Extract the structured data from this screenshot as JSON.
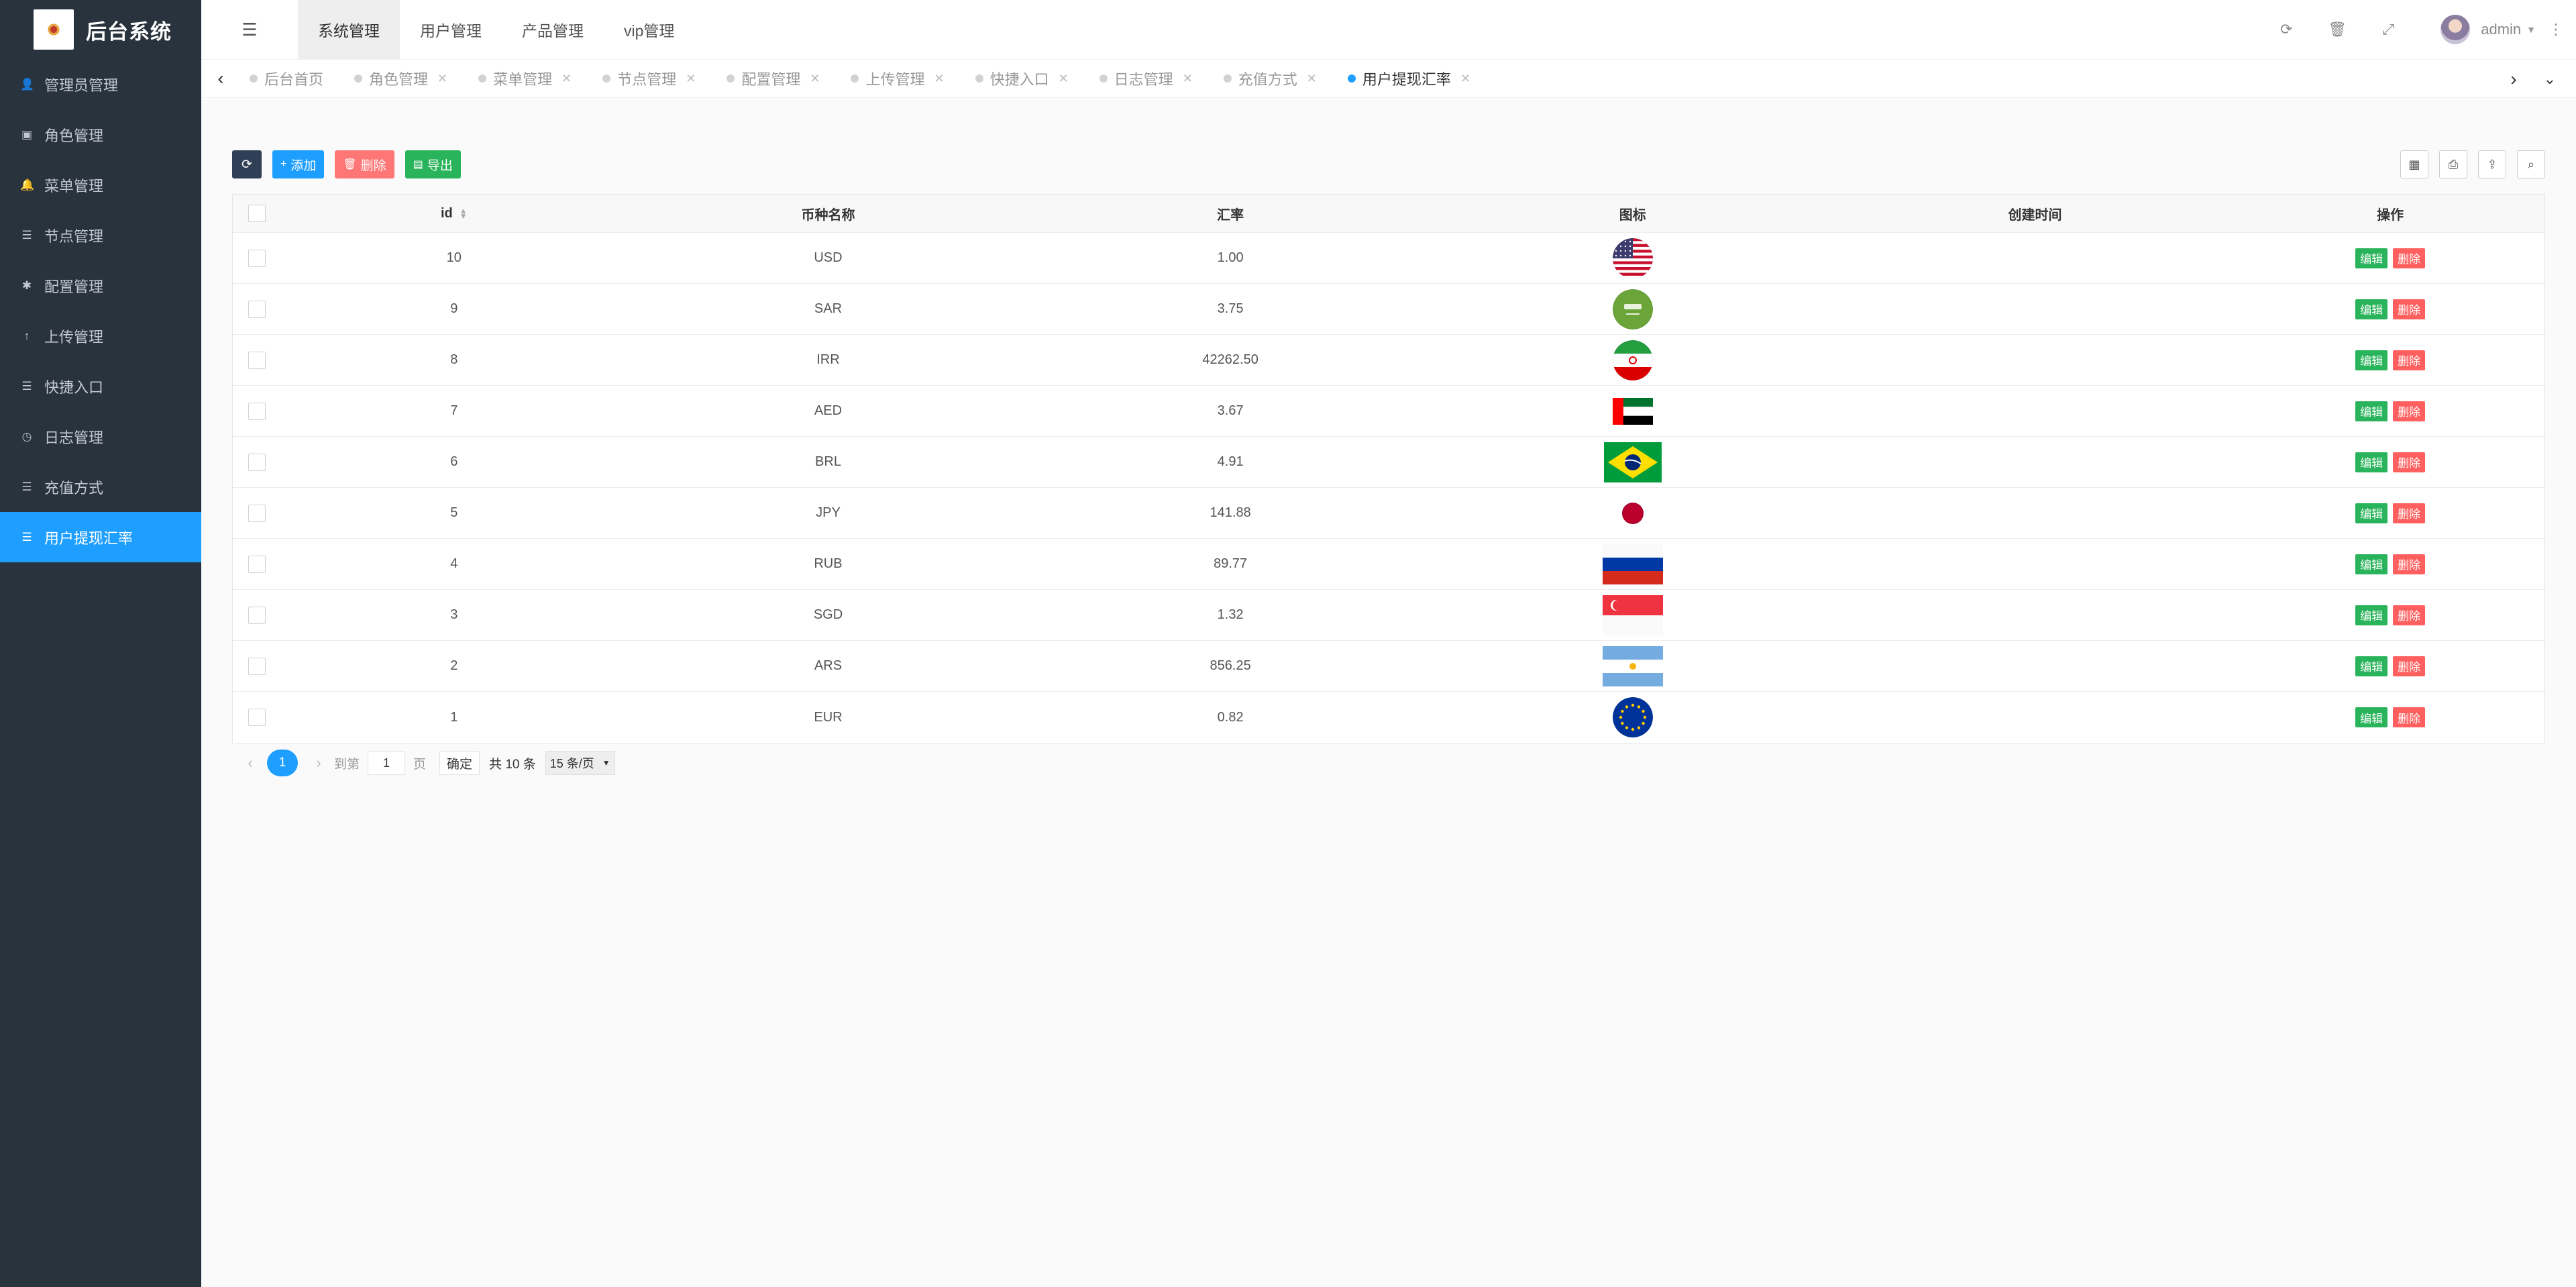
{
  "app": {
    "title": "后台系统"
  },
  "sidebar": {
    "items": [
      {
        "label": "管理员管理",
        "icon": "user-icon"
      },
      {
        "label": "角色管理",
        "icon": "id-card-icon"
      },
      {
        "label": "菜单管理",
        "icon": "bell-icon"
      },
      {
        "label": "节点管理",
        "icon": "list-icon"
      },
      {
        "label": "配置管理",
        "icon": "gear-icon"
      },
      {
        "label": "上传管理",
        "icon": "upload-icon"
      },
      {
        "label": "快捷入口",
        "icon": "list-icon"
      },
      {
        "label": "日志管理",
        "icon": "clock-icon"
      },
      {
        "label": "充值方式",
        "icon": "list-icon"
      },
      {
        "label": "用户提现汇率",
        "icon": "list-icon",
        "active": true
      }
    ]
  },
  "header": {
    "nav": [
      "系统管理",
      "用户管理",
      "产品管理",
      "vip管理"
    ],
    "user": "admin"
  },
  "tabs": [
    {
      "label": "后台首页",
      "closable": false
    },
    {
      "label": "角色管理",
      "closable": true
    },
    {
      "label": "菜单管理",
      "closable": true
    },
    {
      "label": "节点管理",
      "closable": true
    },
    {
      "label": "配置管理",
      "closable": true
    },
    {
      "label": "上传管理",
      "closable": true
    },
    {
      "label": "快捷入口",
      "closable": true
    },
    {
      "label": "日志管理",
      "closable": true
    },
    {
      "label": "充值方式",
      "closable": true
    },
    {
      "label": "用户提现汇率",
      "closable": true,
      "active": true
    }
  ],
  "toolbar": {
    "add_label": "添加",
    "delete_label": "删除",
    "export_label": "导出"
  },
  "table": {
    "columns": [
      "id",
      "币种名称",
      "汇率",
      "图标",
      "创建时间",
      "操作"
    ],
    "edit_label": "编辑",
    "delete_label": "删除",
    "rows": [
      {
        "id": "10",
        "name": "USD",
        "rate": "1.00",
        "flag": "us",
        "created": ""
      },
      {
        "id": "9",
        "name": "SAR",
        "rate": "3.75",
        "flag": "sa",
        "created": ""
      },
      {
        "id": "8",
        "name": "IRR",
        "rate": "42262.50",
        "flag": "ir",
        "created": ""
      },
      {
        "id": "7",
        "name": "AED",
        "rate": "3.67",
        "flag": "ae",
        "created": ""
      },
      {
        "id": "6",
        "name": "BRL",
        "rate": "4.91",
        "flag": "br",
        "created": ""
      },
      {
        "id": "5",
        "name": "JPY",
        "rate": "141.88",
        "flag": "jp",
        "created": ""
      },
      {
        "id": "4",
        "name": "RUB",
        "rate": "89.77",
        "flag": "ru",
        "created": ""
      },
      {
        "id": "3",
        "name": "SGD",
        "rate": "1.32",
        "flag": "sg",
        "created": ""
      },
      {
        "id": "2",
        "name": "ARS",
        "rate": "856.25",
        "flag": "ar",
        "created": ""
      },
      {
        "id": "1",
        "name": "EUR",
        "rate": "0.82",
        "flag": "eu",
        "created": ""
      }
    ]
  },
  "pagination": {
    "current": "1",
    "goto_label": "到第",
    "page_input": "1",
    "page_unit": "页",
    "confirm_label": "确定",
    "total_label": "共 10 条",
    "page_size": "15 条/页"
  },
  "colors": {
    "sidebar_bg": "#28333e",
    "accent": "#1e9fff",
    "success": "#29b35a",
    "danger": "#ff5f5f"
  }
}
